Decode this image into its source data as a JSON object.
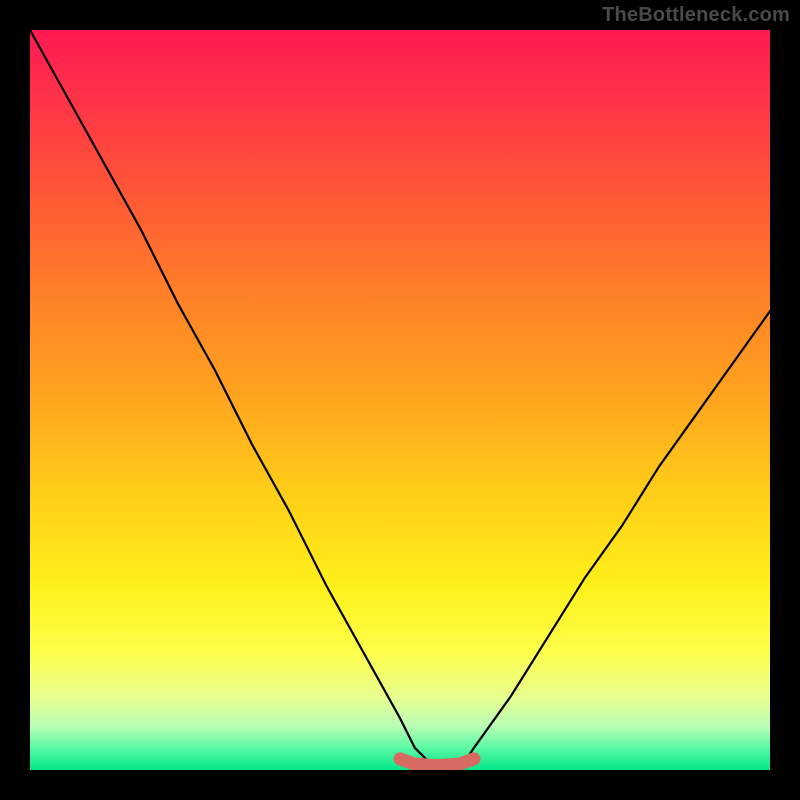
{
  "watermark": "TheBottleneck.com",
  "chart_data": {
    "type": "line",
    "title": "",
    "xlabel": "",
    "ylabel": "",
    "xlim": [
      0,
      100
    ],
    "ylim": [
      0,
      100
    ],
    "series": [
      {
        "name": "bottleneck-curve",
        "x": [
          0,
          5,
          10,
          15,
          20,
          25,
          30,
          35,
          40,
          45,
          50,
          52,
          55,
          58,
          60,
          65,
          70,
          75,
          80,
          85,
          90,
          95,
          100
        ],
        "values": [
          100,
          91,
          82,
          73,
          63,
          54,
          44,
          35,
          25,
          16,
          7,
          3,
          0,
          0,
          3,
          10,
          18,
          26,
          33,
          41,
          48,
          55,
          62
        ]
      },
      {
        "name": "optimal-band",
        "x": [
          50,
          52,
          55,
          58,
          60
        ],
        "values": [
          1.5,
          0.8,
          0.6,
          0.8,
          1.5
        ]
      }
    ],
    "annotations": [],
    "legend": false,
    "grid": false,
    "background_gradient": {
      "stops": [
        {
          "pos": 0.0,
          "color": "#ff1a52"
        },
        {
          "pos": 0.5,
          "color": "#ffa61e"
        },
        {
          "pos": 0.84,
          "color": "#fdff4a"
        },
        {
          "pos": 1.0,
          "color": "#00e887"
        }
      ]
    }
  }
}
